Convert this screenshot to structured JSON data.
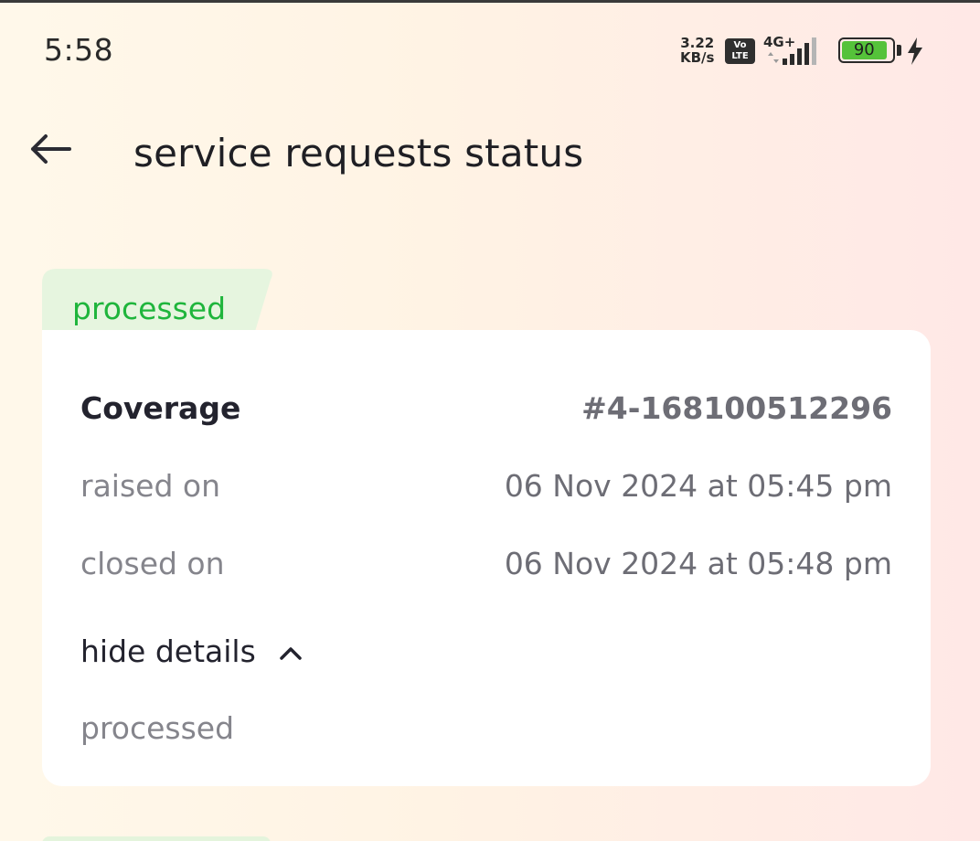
{
  "status_bar": {
    "time": "5:58",
    "net_speed_value": "3.22",
    "net_speed_unit": "KB/s",
    "volte_top": "Vo",
    "volte_bottom": "LTE",
    "network_type": "4G+",
    "battery_level": "90",
    "battery_color": "#55c23a"
  },
  "header": {
    "title": "service requests status"
  },
  "request": {
    "status": "processed",
    "status_color": "#1fb53c",
    "type": "Coverage",
    "id": "#4-168100512296",
    "raised_label": "raised on",
    "raised_value": "06 Nov 2024 at 05:45 pm",
    "closed_label": "closed on",
    "closed_value": "06 Nov 2024 at 05:48 pm",
    "toggle_label": "hide details",
    "details": "processed"
  }
}
